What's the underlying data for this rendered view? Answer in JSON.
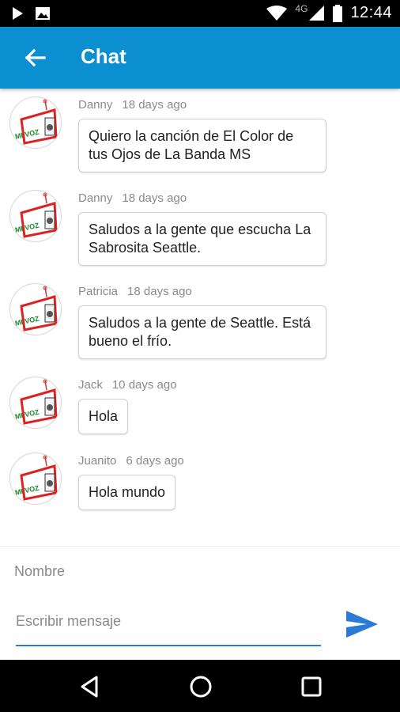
{
  "status_bar": {
    "time": "12:44",
    "network": "4G",
    "icons": [
      "play-icon",
      "image-icon",
      "wifi-icon",
      "signal-icon",
      "battery-icon"
    ]
  },
  "app_bar": {
    "title": "Chat",
    "back_icon": "arrow-back-icon",
    "color": "#0b8fd1"
  },
  "messages": [
    {
      "author": "Danny",
      "time": "18 days ago",
      "text": "Quiero la canción de El Color de tus Ojos de La Banda MS"
    },
    {
      "author": "Danny",
      "time": "18 days ago",
      "text": "Saludos a la gente que escucha La Sabrosita Seattle."
    },
    {
      "author": "Patricia",
      "time": "18 days ago",
      "text": "Saludos a la gente de Seattle. Está bueno el frío."
    },
    {
      "author": "Jack",
      "time": "10 days ago",
      "text": "Hola"
    },
    {
      "author": "Juanito",
      "time": "6 days ago",
      "text": "Hola mundo"
    }
  ],
  "composer": {
    "name_placeholder": "Nombre",
    "message_placeholder": "Escribir mensaje",
    "send_icon": "send-icon",
    "accent": "#2b7bd6"
  },
  "nav_bar": {
    "icons": [
      "back-triangle-icon",
      "home-circle-icon",
      "recents-square-icon"
    ]
  }
}
